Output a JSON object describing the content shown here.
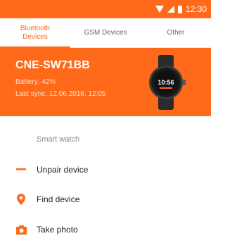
{
  "status_bar": {
    "time": "12:30"
  },
  "tabs": [
    {
      "label": "Bluetooth Devices",
      "active": true
    },
    {
      "label": "GSM Devices",
      "active": false
    },
    {
      "label": "Other",
      "active": false
    }
  ],
  "device": {
    "name": "CNE-SW71BB",
    "battery": "Battery: 42%",
    "last_sync": "Last sync: 12.06.2018, 12:05",
    "watch_time": "10:56"
  },
  "section": {
    "label": "Smart watch"
  },
  "menu": [
    {
      "label": "Unpair device",
      "icon": "minus-icon"
    },
    {
      "label": "Find device",
      "icon": "location-pin-icon"
    },
    {
      "label": "Take photo",
      "icon": "camera-icon"
    }
  ],
  "colors": {
    "accent": "#ff6a1a",
    "text": "#222222",
    "muted": "#888888"
  }
}
